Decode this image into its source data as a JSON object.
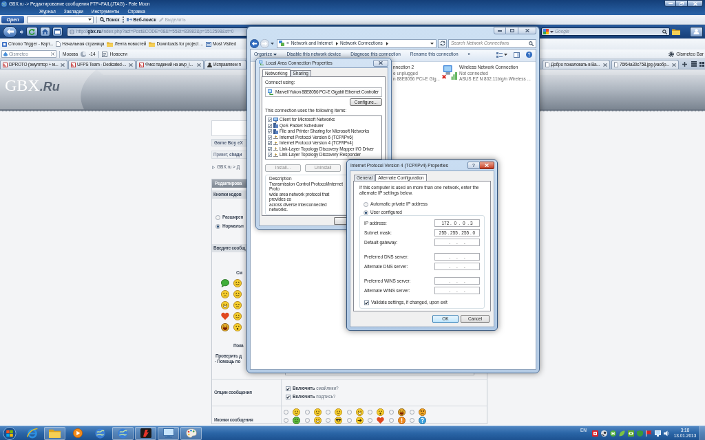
{
  "browser": {
    "title": "GBX.ru -> Редактирование сообщения FTP=FAIL(JTAG) - Pale Moon",
    "menu": [
      "Журнал",
      "Закладки",
      "Инструменты",
      "Справка"
    ],
    "search_toolbar": {
      "logo": "Open",
      "search": "Поиск",
      "web_search": "Веб-поиск",
      "highlight": {
        "label": "Выделить",
        "disabled": true
      }
    },
    "address": "http://**gbx.ru**/index.php?act=Post&CODE=08&f=55&t=83982&p=1512598&st=0",
    "search_placeholder": "Google",
    "bookmarks": [
      {
        "label": "Chrono Trigger - Карт...",
        "kind": "site"
      },
      {
        "label": "Начальная страница",
        "kind": "page"
      },
      {
        "label": "Лента новостей",
        "kind": "folder"
      },
      {
        "label": "Downloads for project ...",
        "kind": "folder"
      },
      {
        "label": "Most Visited",
        "kind": "smart"
      }
    ],
    "weather_bar": {
      "search_placeholder": "Gismeteo",
      "city": "Москва",
      "temperature": "-14",
      "news": "Новости",
      "bar_button": "Gismeteo Bar"
    },
    "tabs": [
      {
        "label": "DPROTO (эмулятор + м...",
        "selected": false
      },
      {
        "label": "UFPS Team - Dedicated-...",
        "selected": false
      },
      {
        "label": "Фикс падений на awp_i...",
        "selected": false
      },
      {
        "label": "Исправляем п",
        "selected": false
      }
    ],
    "more_tabs": [
      {
        "label": "Добро пожаловать в Ва...",
        "selected": false
      },
      {
        "label": "76f64a30c758.jpg (изобр...",
        "selected": false
      }
    ]
  },
  "forum": {
    "logo": "GBX**.Ru**",
    "forum_title": "Game Boy eX",
    "greeting": "Привет, **chади**",
    "breadcrumb": "GBX.ru > Д",
    "edit_header": "Редактирова",
    "code_buttons_label": "Кнопки кодов",
    "mode_options": [
      {
        "label": "Расширен",
        "selected": false
      },
      {
        "label": "Нормальн",
        "selected": true
      }
    ],
    "message_label": "Введите сообщ",
    "smilies_label": "См",
    "show_all": "Пока",
    "check_length": "Проверить д",
    "help": "· Помощь по",
    "options_label": "Опции сообщения",
    "options": [
      {
        "label": "**Включить** смайлики?",
        "checked": true
      },
      {
        "label": "**Включить** подпись?",
        "checked": true
      }
    ],
    "icons_label": "Иконки сообщения",
    "post_icons": [
      {
        "selected": false
      },
      {
        "selected": false
      },
      {
        "selected": false
      },
      {
        "selected": false
      },
      {
        "selected": false
      },
      {
        "selected": false
      },
      {
        "selected": false
      },
      {
        "selected": false
      },
      {
        "selected": false
      },
      {
        "selected": false
      },
      {
        "selected": false
      },
      {
        "selected": false
      },
      {
        "selected": false
      },
      {
        "selected": false
      }
    ]
  },
  "explorer": {
    "breadcrumb_overflow": "«",
    "breadcrumb": [
      "Network and Internet",
      "Network Connections"
    ],
    "search_placeholder": "Search Network Connections",
    "commands": [
      {
        "label": "Organize",
        "kind": "menu"
      },
      {
        "label": "Disable this network device",
        "kind": "action"
      },
      {
        "label": "Diagnose this connection",
        "kind": "action"
      },
      {
        "label": "Rename this connection",
        "kind": "action"
      },
      {
        "label": "»",
        "kind": "action"
      }
    ],
    "connections": [
      {
        "kind": "wired",
        "name": "nnection 2",
        "status": "e unplugged",
        "device": "n 88E8056 PCI-E Gig..."
      },
      {
        "kind": "wireless",
        "name": "Wireless Network Connection",
        "status": "Not connected",
        "device": "ASUS EZ N 802.11b/g/n Wireless ..."
      }
    ]
  },
  "lan_properties": {
    "title": "Local Area Connection Properties",
    "tabs": [
      {
        "label": "Networking",
        "selected": true
      },
      {
        "label": "Sharing",
        "selected": false
      }
    ],
    "connect_using_label": "Connect using:",
    "adapter": "Marvell Yukon 88E8056 PCI-E Gigabit Ethernet Controller",
    "configure_button": "Configure...",
    "items_label": "This connection uses the following items:",
    "items": [
      {
        "label": "Client for Microsoft Networks",
        "kind": "client",
        "checked": true
      },
      {
        "label": "QoS Packet Scheduler",
        "kind": "service",
        "checked": true
      },
      {
        "label": "File and Printer Sharing for Microsoft Networks",
        "kind": "service",
        "checked": true
      },
      {
        "label": "Internet Protocol Version 6 (TCP/IPv6)",
        "kind": "protocol",
        "checked": true
      },
      {
        "label": "Internet Protocol Version 4 (TCP/IPv4)",
        "kind": "protocol",
        "checked": true
      },
      {
        "label": "Link-Layer Topology Discovery Mapper I/O Driver",
        "kind": "protocol",
        "checked": true
      },
      {
        "label": "Link-Layer Topology Discovery Responder",
        "kind": "protocol",
        "checked": true
      }
    ],
    "buttons": [
      {
        "label": "Install...",
        "disabled": true
      },
      {
        "label": "Uninstall",
        "disabled": true
      }
    ],
    "description_label": "Description",
    "description_lines": [
      "Transmission Control Protocol/Internet Proto",
      "wide area network protocol that provides co",
      "across diverse interconnected networks."
    ]
  },
  "ipv4_properties": {
    "title": "Internet Protocol Version 4 (TCP/IPv4) Properties",
    "help_button": "?",
    "tabs": [
      {
        "label": "General",
        "selected": false
      },
      {
        "label": "Alternate Configuration",
        "selected": true
      }
    ],
    "intro": "If this computer is used on more than one network, enter the alternate IP settings below.",
    "modes": [
      {
        "label": "Automatic private IP address",
        "selected": false
      },
      {
        "label": "User configured",
        "selected": true
      }
    ],
    "field_groups": [
      [
        {
          "label": "IP address:",
          "value": "172 .  0  .  0  . 3"
        },
        {
          "label": "Subnet mask:",
          "value": "255 . 255 . 255 . 0"
        },
        {
          "label": "Default gateway:",
          "value": ".     .     ."
        }
      ],
      [
        {
          "label": "Preferred DNS server:",
          "value": ".     .     ."
        },
        {
          "label": "Alternate DNS server:",
          "value": ".     .     ."
        }
      ],
      [
        {
          "label": "Preferred WINS server:",
          "value": ".     .     ."
        },
        {
          "label": "Alternate WINS server:",
          "value": ".     .     ."
        }
      ]
    ],
    "validate": {
      "label": "Validate settings, if changed, upon exit",
      "checked": true
    },
    "buttons": [
      {
        "label": "OK",
        "kind": "default"
      },
      {
        "label": "Cancel",
        "kind": "normal"
      }
    ]
  },
  "taskbar": {
    "apps": [
      {
        "running": false
      },
      {
        "running": true
      },
      {
        "running": false
      },
      {
        "running": false
      },
      {
        "running": true
      },
      {
        "running": true
      },
      {
        "running": true
      },
      {
        "running": true
      }
    ],
    "language": "EN",
    "time": "3:18",
    "date": "13.01.2013"
  }
}
